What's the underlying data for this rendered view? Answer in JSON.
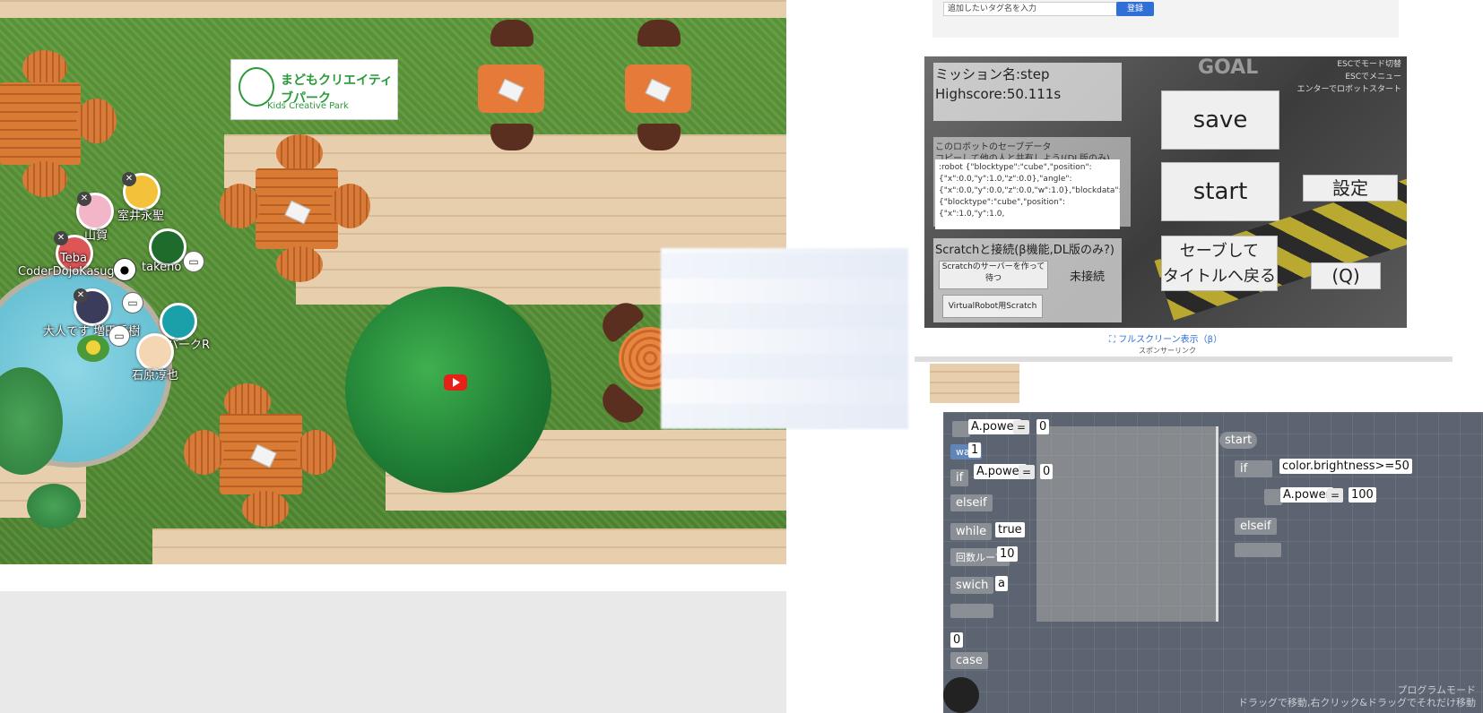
{
  "map": {
    "logo": {
      "line1": "まどもクリエイティブパーク",
      "line2": "Kids Creative Park"
    },
    "users": [
      {
        "name": "室井永聖"
      },
      {
        "name": "山賀"
      },
      {
        "name": "Teba"
      },
      {
        "name": "CoderDojoKasuga"
      },
      {
        "name": "takeno"
      },
      {
        "name": "大人です 増田秀樹"
      },
      {
        "name": "鉄道パークR"
      },
      {
        "name": "石原淳也"
      }
    ]
  },
  "tag": {
    "placeholder": "追加したいタグ名を入力",
    "register_label": "登録"
  },
  "game": {
    "goal_label": "GOAL",
    "mission_name": "ミッション名:step",
    "highscore": "Highscore:50.111s",
    "save_header_line1": "このロボットのセーブデータ",
    "save_header_line2": "コピーして他の人と共有しよう!(DL版のみ)",
    "save_text": ":robot {\"blocktype\":\"cube\",\"position\":{\"x\":0.0,\"y\":1.0,\"z\":0.0},\"angle\":{\"x\":0.0,\"y\":0.0,\"z\":0.0,\"w\":1.0},\"blockdata\":\"\"} {\"blocktype\":\"cube\",\"position\":{\"x\":1.0,\"y\":1.0,",
    "scratch_title": "Scratchと接続(β機能,DL版のみ?)",
    "server_button": "Scratchのサーバーを作って待つ",
    "connection_status": "未接続",
    "vr_scratch_button": "VirtualRobot用Scratch",
    "buttons": {
      "save": "save",
      "start": "start",
      "settings": "設定",
      "back_line1": "セーブして",
      "back_line2": "タイトルへ戻る",
      "q": "(Q)"
    },
    "hints": [
      "ESCでモード切替",
      "ESCでメニュー",
      "エンターでロボットスタート"
    ],
    "fullscreen_label": "フルスクリーン表示（β）",
    "sponsor_label": "スポンサーリンク"
  },
  "editor": {
    "palette": {
      "apower1": "A.power",
      "eq1": "=",
      "val1": "0",
      "wait_label": "wait",
      "wait_val": "1",
      "if_label": "if",
      "apower2": "A.power",
      "eq2": "=",
      "val2": "0",
      "elseif_label": "elseif",
      "while_label": "while",
      "while_val": "true",
      "loop_label": "回数ループ",
      "loop_val": "10",
      "switch_label": "swich",
      "switch_val": "a",
      "zero_val": "0",
      "case_label": "case"
    },
    "program": {
      "start_label": "start",
      "if_label": "if",
      "condition": "color.brightness>=50",
      "target": "A.power",
      "eq": "=",
      "value": "100",
      "elseif_label": "elseif"
    },
    "hint_line1": "プログラムモード",
    "hint_line2": "ドラッグで移動,右クリック&ドラッグでそれだけ移動"
  }
}
